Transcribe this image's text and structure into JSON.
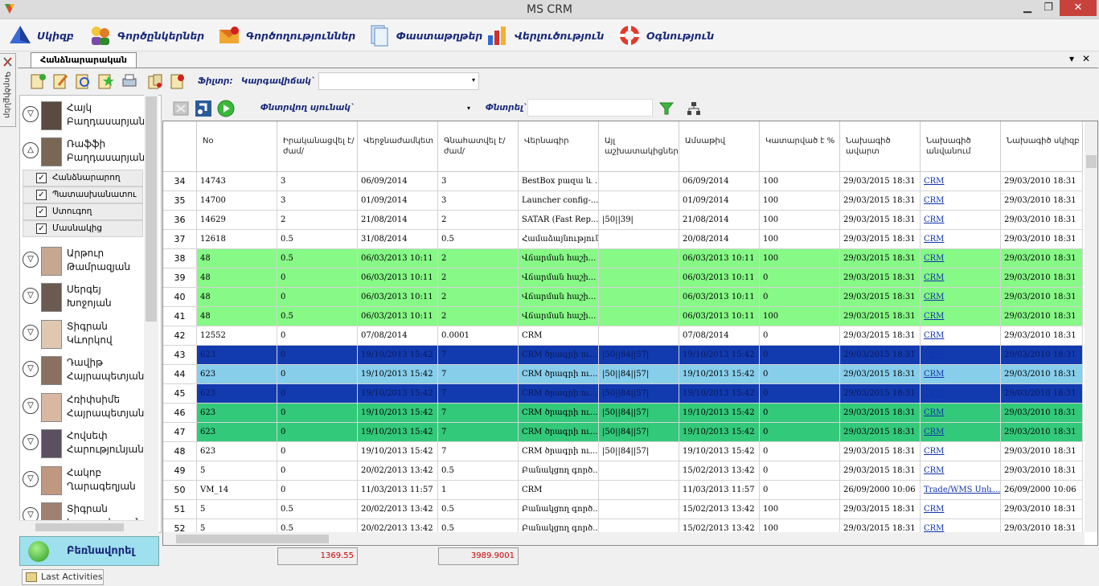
{
  "window": {
    "title": "MS CRM",
    "minimize": "▁",
    "maximize": "❐",
    "close": "✕"
  },
  "menu": [
    {
      "label": "Սկիզբ",
      "icon": "pyramid-icon"
    },
    {
      "label": "Գործընկերներ",
      "icon": "partners-icon"
    },
    {
      "label": "Գործողություններ",
      "icon": "actions-icon"
    },
    {
      "label": "Փաստաթղթեր",
      "icon": "documents-icon"
    },
    {
      "label": "Վերլուծություն",
      "icon": "analysis-icon"
    },
    {
      "label": "Օգնություն",
      "icon": "lifebuoy-icon"
    }
  ],
  "side_tab": {
    "label": "Գործիքներ"
  },
  "doc_tab": {
    "label": "Հանձնարարական",
    "dropdown": "▾",
    "close": "✕"
  },
  "filter": {
    "type_label": "Ֆիլտր:",
    "state_label": "Կարգավիճակ`",
    "state_value": "",
    "dropdown": "▾"
  },
  "toolbar2": {
    "col_search_label": "Փնտրվող սյունակ`",
    "search_label": "Փնտրել`",
    "search_value": "",
    "dropdown": "▾"
  },
  "people": [
    {
      "name": "Հայկ Բաղդասարյան",
      "expanded": false
    },
    {
      "name": "Ռաֆֆի Բաղդասարյան",
      "expanded": true,
      "roles": [
        "Հանձնարարող",
        "Պատասխանատու",
        "Ստուգող",
        "Մասնակից"
      ]
    },
    {
      "name": "Արթուր Թամրազյան",
      "expanded": false
    },
    {
      "name": "Սերգեյ Խոջոյան",
      "expanded": false
    },
    {
      "name": "Տիգրան Կևորկով",
      "expanded": false
    },
    {
      "name": "Դավիթ Հայրապետյան",
      "expanded": false
    },
    {
      "name": "Հռիփսիմե Հայրապետյան",
      "expanded": false
    },
    {
      "name": "Հովսեփ Հարությունյան",
      "expanded": false
    },
    {
      "name": "Հակոբ Ղարագեղյան",
      "expanded": false
    },
    {
      "name": "Տիգրան Կարապետյան",
      "expanded": false
    }
  ],
  "go_button": {
    "label": "Բեռնավորել"
  },
  "grid": {
    "columns": [
      "No",
      "Իրականացվել է/ժամ/",
      "Վերջնաժամկետ",
      "Գնահատվել է/ժամ/",
      "Վերնագիր",
      "Այլ աշխատակիցներ",
      "Ամսաթիվ",
      "Կատարված է %",
      "Նախագիծ ավարտ",
      "Նախագիծ անվանում",
      "Նախագիծ սկիզբ"
    ],
    "rows": [
      {
        "n": "34",
        "c": [
          "14743",
          "3",
          "06/09/2014",
          "3",
          "BestBox բազա և ...",
          "",
          "06/09/2014",
          "100",
          "29/03/2015 18:31",
          "CRM",
          "29/03/2010 18:31"
        ],
        "bg": "#ffffff",
        "fg": "#000000"
      },
      {
        "n": "35",
        "c": [
          "14700",
          "3",
          "01/09/2014",
          "3",
          "Launcher config-...",
          "",
          "01/09/2014",
          "100",
          "29/03/2015 18:31",
          "CRM",
          "29/03/2010 18:31"
        ],
        "bg": "#ffffff",
        "fg": "#000000"
      },
      {
        "n": "36",
        "c": [
          "14629",
          "2",
          "21/08/2014",
          "2",
          "SATAR (Fast Rep...",
          "|50||39|",
          "21/08/2014",
          "100",
          "29/03/2015 18:31",
          "CRM",
          "29/03/2010 18:31"
        ],
        "bg": "#ffffff",
        "fg": "#000000"
      },
      {
        "n": "37",
        "c": [
          "12618",
          "0.5",
          "31/08/2014",
          "0.5",
          "Համաձայնություն...",
          "",
          "20/08/2014",
          "100",
          "29/03/2015 18:31",
          "CRM",
          "29/03/2010 18:31"
        ],
        "bg": "#ffffff",
        "fg": "#000000"
      },
      {
        "n": "38",
        "c": [
          "48",
          "0.5",
          "06/03/2013 10:11",
          "2",
          "Վճարման հաշի...",
          "",
          "06/03/2013 10:11",
          "100",
          "29/03/2015 18:31",
          "CRM",
          "29/03/2010 18:31"
        ],
        "bg": "#86f986",
        "fg": "#000000"
      },
      {
        "n": "39",
        "c": [
          "48",
          "0",
          "06/03/2013 10:11",
          "2",
          "Վճարման հաշի...",
          "",
          "06/03/2013 10:11",
          "0",
          "29/03/2015 18:31",
          "CRM",
          "29/03/2010 18:31"
        ],
        "bg": "#86f986",
        "fg": "#000000"
      },
      {
        "n": "40",
        "c": [
          "48",
          "0",
          "06/03/2013 10:11",
          "2",
          "Վճարման հաշի...",
          "",
          "06/03/2013 10:11",
          "0",
          "29/03/2015 18:31",
          "CRM",
          "29/03/2010 18:31"
        ],
        "bg": "#86f986",
        "fg": "#000000"
      },
      {
        "n": "41",
        "c": [
          "48",
          "0.5",
          "06/03/2013 10:11",
          "2",
          "Վճարման հաշի...",
          "",
          "06/03/2013 10:11",
          "100",
          "29/03/2015 18:31",
          "CRM",
          "29/03/2010 18:31"
        ],
        "bg": "#86f986",
        "fg": "#000000"
      },
      {
        "n": "42",
        "c": [
          "12552",
          "0",
          "07/08/2014",
          "0.0001",
          "CRM",
          "",
          "07/08/2014",
          "0",
          "29/03/2015 18:31",
          "CRM",
          "29/03/2010 18:31"
        ],
        "bg": "#ffffff",
        "fg": "#000000"
      },
      {
        "n": "43",
        "c": [
          "623",
          "0",
          "19/10/2013 15:42",
          "7",
          "CRM ծրագրի ու...",
          "|50||84||57|",
          "19/10/2013 15:42",
          "0",
          "29/03/2015 18:31",
          "CRM",
          "29/03/2010 18:31"
        ],
        "bg": "#123bb0",
        "fg": "#0a1a55"
      },
      {
        "n": "44",
        "c": [
          "623",
          "0",
          "19/10/2013 15:42",
          "7",
          "CRM ծրագրի ու...",
          "|50||84||57|",
          "19/10/2013 15:42",
          "0",
          "29/03/2015 18:31",
          "CRM",
          "29/03/2010 18:31"
        ],
        "bg": "#87ceeb",
        "fg": "#000000",
        "current": true
      },
      {
        "n": "45",
        "c": [
          "623",
          "0",
          "19/10/2013 15:42",
          "7",
          "CRM ծրագրի ու...",
          "|50||84||57|",
          "19/10/2013 15:42",
          "0",
          "29/03/2015 18:31",
          "CRM",
          "29/03/2010 18:31"
        ],
        "bg": "#123bb0",
        "fg": "#0a1a55"
      },
      {
        "n": "46",
        "c": [
          "623",
          "0",
          "19/10/2013 15:42",
          "7",
          "CRM ծրագրի ու...",
          "|50||84||57|",
          "19/10/2013 15:42",
          "0",
          "29/03/2015 18:31",
          "CRM",
          "29/03/2010 18:31"
        ],
        "bg": "#33c97a",
        "fg": "#000000"
      },
      {
        "n": "47",
        "c": [
          "623",
          "0",
          "19/10/2013 15:42",
          "7",
          "CRM ծրագրի ու...",
          "|50||84||57|",
          "19/10/2013 15:42",
          "0",
          "29/03/2015 18:31",
          "CRM",
          "29/03/2010 18:31"
        ],
        "bg": "#33c97a",
        "fg": "#000000"
      },
      {
        "n": "48",
        "c": [
          "623",
          "0",
          "19/10/2013 15:42",
          "7",
          "CRM ծրագրի ու...",
          "|50||84||57|",
          "19/10/2013 15:42",
          "0",
          "29/03/2015 18:31",
          "CRM",
          "29/03/2010 18:31"
        ],
        "bg": "#ffffff",
        "fg": "#000000"
      },
      {
        "n": "49",
        "c": [
          "5",
          "0",
          "20/02/2013 13:42",
          "0.5",
          "Բանակցող գործ...",
          "",
          "15/02/2013 13:42",
          "0",
          "29/03/2015 18:31",
          "CRM",
          "29/03/2010 18:31"
        ],
        "bg": "#ffffff",
        "fg": "#000000"
      },
      {
        "n": "50",
        "c": [
          "VM_14",
          "0",
          "11/03/2013 11:57",
          "1",
          "CRM",
          "",
          "11/03/2013 11:57",
          "0",
          "26/09/2000 10:06",
          "Trade/WMS Սոև...",
          "26/09/2000 10:06"
        ],
        "bg": "#ffffff",
        "fg": "#000000"
      },
      {
        "n": "51",
        "c": [
          "5",
          "0.5",
          "20/02/2013 13:42",
          "0.5",
          "Բանակցող գործ...",
          "",
          "15/02/2013 13:42",
          "100",
          "29/03/2015 18:31",
          "CRM",
          "29/03/2010 18:31"
        ],
        "bg": "#ffffff",
        "fg": "#000000"
      },
      {
        "n": "52",
        "c": [
          "5",
          "0.5",
          "20/02/2013 13:42",
          "0.5",
          "Բանակցող գործ...",
          "",
          "15/02/2013 13:42",
          "100",
          "29/03/2015 18:31",
          "CRM",
          "29/03/2010 18:31"
        ],
        "bg": "#ffffff",
        "fg": "#000000"
      }
    ]
  },
  "totals": {
    "done_hours": "1369.55",
    "estimated_hours": "3989.9001"
  },
  "status": {
    "tab_label": "Last Activities"
  }
}
